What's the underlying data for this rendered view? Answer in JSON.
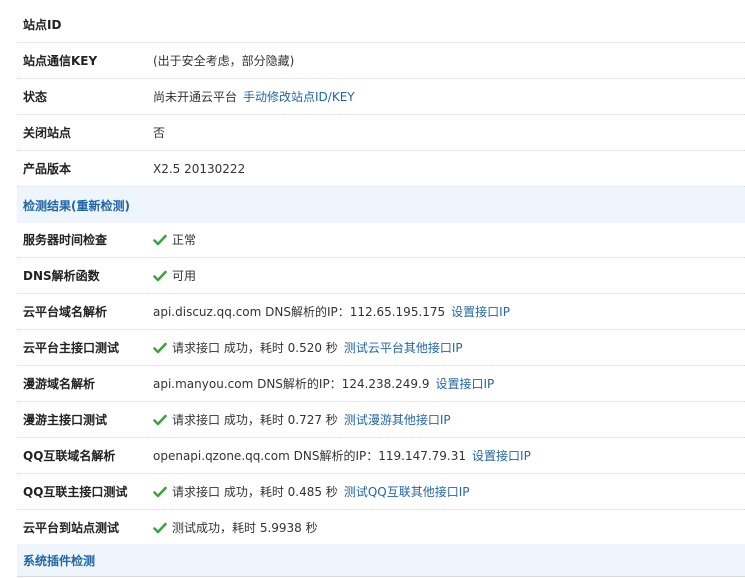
{
  "rows_top": [
    {
      "label": "站点ID",
      "value": ""
    },
    {
      "label": "站点通信KEY",
      "value": "(出于安全考虑，部分隐藏)"
    },
    {
      "label": "状态",
      "value": "尚未开通云平台",
      "link": "手动修改站点ID/KEY"
    },
    {
      "label": "关闭站点",
      "value": "否"
    },
    {
      "label": "产品版本",
      "value": "X2.5 20130222"
    }
  ],
  "section_check": {
    "title": "检测结果(重新检测)"
  },
  "checks": [
    {
      "label": "服务器时间检查",
      "value": "正常",
      "icon": "check-icon"
    },
    {
      "label": "DNS解析函数",
      "value": "可用",
      "icon": "check-icon"
    },
    {
      "label": "云平台域名解析",
      "value": "api.discuz.qq.com DNS解析的IP：112.65.195.175",
      "link": "设置接口IP"
    },
    {
      "label": "云平台主接口测试",
      "value": "请求接口 成功，耗时 0.520 秒",
      "link": "测试云平台其他接口IP",
      "icon": "check-icon"
    },
    {
      "label": "漫游域名解析",
      "value": "api.manyou.com DNS解析的IP：124.238.249.9",
      "link": "设置接口IP"
    },
    {
      "label": "漫游主接口测试",
      "value": "请求接口 成功，耗时 0.727 秒",
      "link": "测试漫游其他接口IP",
      "icon": "check-icon"
    },
    {
      "label": "QQ互联域名解析",
      "value": "openapi.qzone.qq.com DNS解析的IP：119.147.79.31",
      "link": "设置接口IP"
    },
    {
      "label": "QQ互联主接口测试",
      "value": "请求接口 成功，耗时 0.485 秒",
      "link": "测试QQ互联其他接口IP",
      "icon": "check-icon"
    },
    {
      "label": "云平台到站点测试",
      "value": "测试成功，耗时 5.9938 秒",
      "icon": "check-icon"
    }
  ],
  "section_plugin": {
    "title": "系统插件检测"
  },
  "colors": {
    "accent": "#2366a8",
    "section_bg": "#eef5fc",
    "check_green": "#3ea33e"
  }
}
